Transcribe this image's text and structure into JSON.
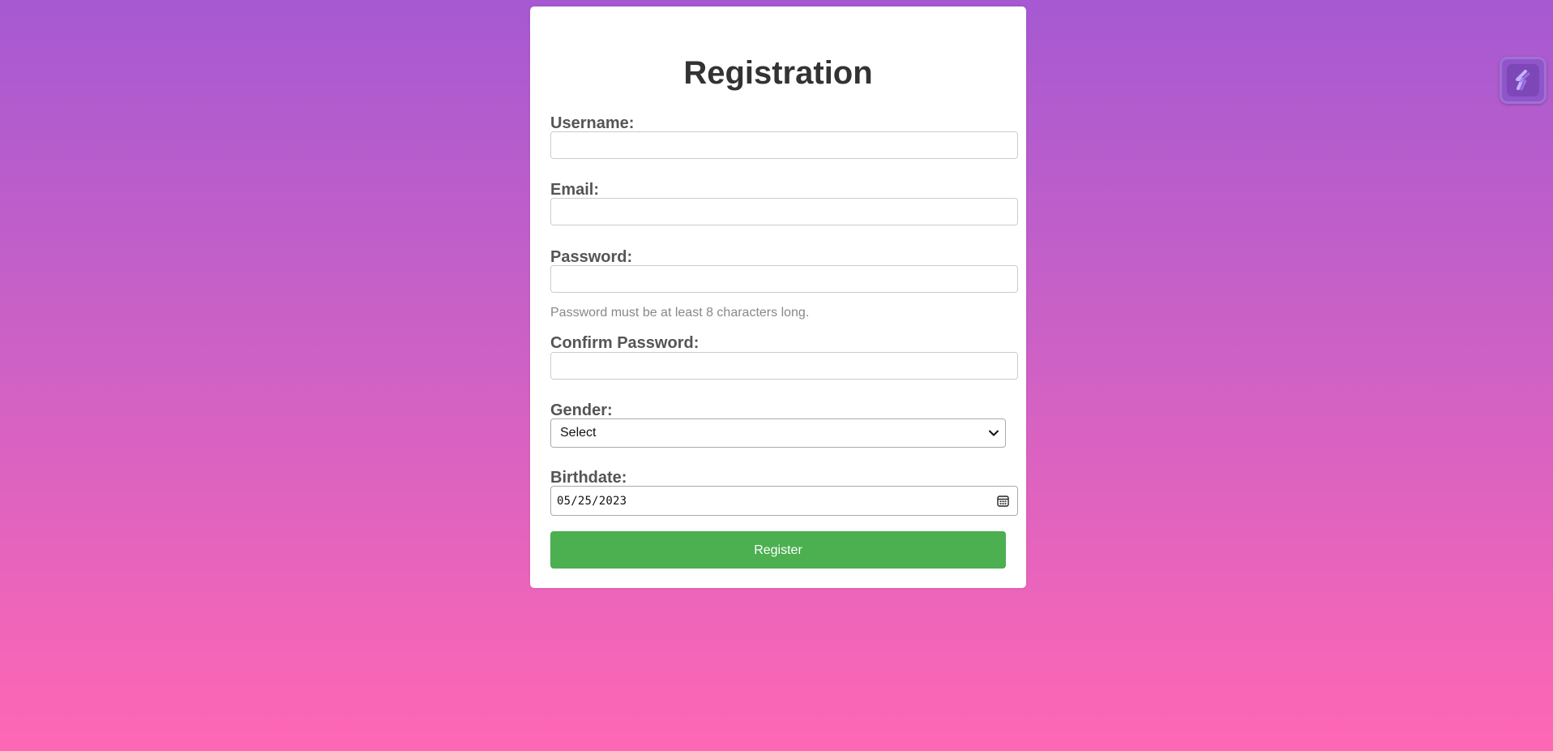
{
  "form": {
    "title": "Registration",
    "username_label": "Username:",
    "username_value": "",
    "email_label": "Email:",
    "email_value": "",
    "password_label": "Password:",
    "password_value": "",
    "password_hint": "Password must be at least 8 characters long.",
    "confirm_label": "Confirm Password:",
    "confirm_value": "",
    "gender_label": "Gender:",
    "gender_selected": "Select",
    "birthdate_label": "Birthdate:",
    "birthdate_value": "05/25/2023",
    "register_label": "Register"
  },
  "colors": {
    "background_top": "#a659d2",
    "background_bottom": "#ff67b4",
    "button": "#4caf50",
    "card": "#ffffff"
  },
  "icons": {
    "select_arrow": "chevron-down-icon",
    "date_picker": "calendar-icon",
    "extension": "lightning-icon"
  }
}
